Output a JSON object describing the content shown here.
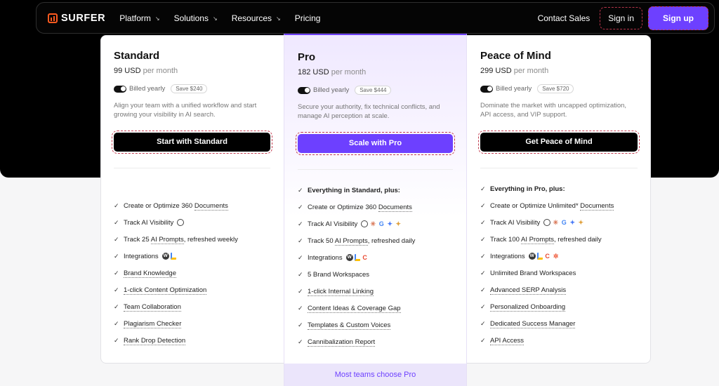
{
  "nav": {
    "logo": "SURFER",
    "links": [
      "Platform",
      "Solutions",
      "Resources",
      "Pricing"
    ],
    "contact": "Contact Sales",
    "signin": "Sign in",
    "signup": "Sign up"
  },
  "plans": [
    {
      "name": "Standard",
      "price": "99 USD",
      "per": "per month",
      "billed": "Billed yearly",
      "save": "Save $240",
      "desc": "Align your team with a unified workflow and start growing your visibility in AI search.",
      "cta": "Start with Standard",
      "features": [
        {
          "pre": "Create or Optimize 360 ",
          "link": "Documents",
          "post": ""
        },
        {
          "pre": "Track AI Visibility",
          "link": "",
          "post": ""
        },
        {
          "pre": "Track 25 ",
          "link": "AI Prompts",
          "post": ", refreshed weekly"
        },
        {
          "pre": "Integrations",
          "link": "",
          "post": ""
        },
        {
          "pre": "",
          "link": "Brand Knowledge",
          "post": ""
        },
        {
          "pre": "",
          "link": "1-click Content Optimization",
          "post": ""
        },
        {
          "pre": "",
          "link": "Team Collaboration",
          "post": ""
        },
        {
          "pre": "",
          "link": "Plagiarism Checker",
          "post": ""
        },
        {
          "pre": "",
          "link": "Rank Drop Detection",
          "post": ""
        }
      ]
    },
    {
      "name": "Pro",
      "price": "182 USD",
      "per": "per month",
      "billed": "Billed yearly",
      "save": "Save $444",
      "desc": "Secure your authority, fix technical conflicts, and manage AI perception at scale.",
      "cta": "Scale with Pro",
      "lead": "Everything in Standard, plus:",
      "features": [
        {
          "pre": "Create or Optimize 360 ",
          "link": "Documents",
          "post": ""
        },
        {
          "pre": "Track AI Visibility",
          "link": "",
          "post": ""
        },
        {
          "pre": "Track 50 ",
          "link": "AI Prompts",
          "post": ", refreshed daily"
        },
        {
          "pre": "Integrations",
          "link": "",
          "post": ""
        },
        {
          "pre": "5 Brand Workspaces",
          "link": "",
          "post": ""
        },
        {
          "pre": "",
          "link": "1-click Internal Linking",
          "post": ""
        },
        {
          "pre": "",
          "link": "Content Ideas & Coverage Gap",
          "post": ""
        },
        {
          "pre": "",
          "link": "Templates & Custom Voices",
          "post": ""
        },
        {
          "pre": "",
          "link": "Cannibalization Report",
          "post": ""
        }
      ]
    },
    {
      "name": "Peace of Mind",
      "price": "299 USD",
      "per": "per month",
      "billed": "Billed yearly",
      "save": "Save $720",
      "desc": "Dominate the market with uncapped optimization, API access, and VIP support.",
      "cta": "Get Peace of Mind",
      "lead": "Everything in Pro, plus:",
      "features": [
        {
          "pre": "Create or Optimize Unlimited* ",
          "link": "Documents",
          "post": ""
        },
        {
          "pre": "Track AI Visibility",
          "link": "",
          "post": ""
        },
        {
          "pre": "Track 100 ",
          "link": "AI Prompts",
          "post": ", refreshed daily"
        },
        {
          "pre": "Integrations",
          "link": "",
          "post": ""
        },
        {
          "pre": "Unlimited Brand Workspaces",
          "link": "",
          "post": ""
        },
        {
          "pre": "",
          "link": "Advanced SERP Analysis",
          "post": ""
        },
        {
          "pre": "",
          "link": "Personalized Onboarding",
          "post": ""
        },
        {
          "pre": "",
          "link": "Dedicated Success Manager",
          "post": ""
        },
        {
          "pre": "",
          "link": "API Access",
          "post": ""
        }
      ]
    }
  ],
  "footer_note": "Most teams choose Pro"
}
